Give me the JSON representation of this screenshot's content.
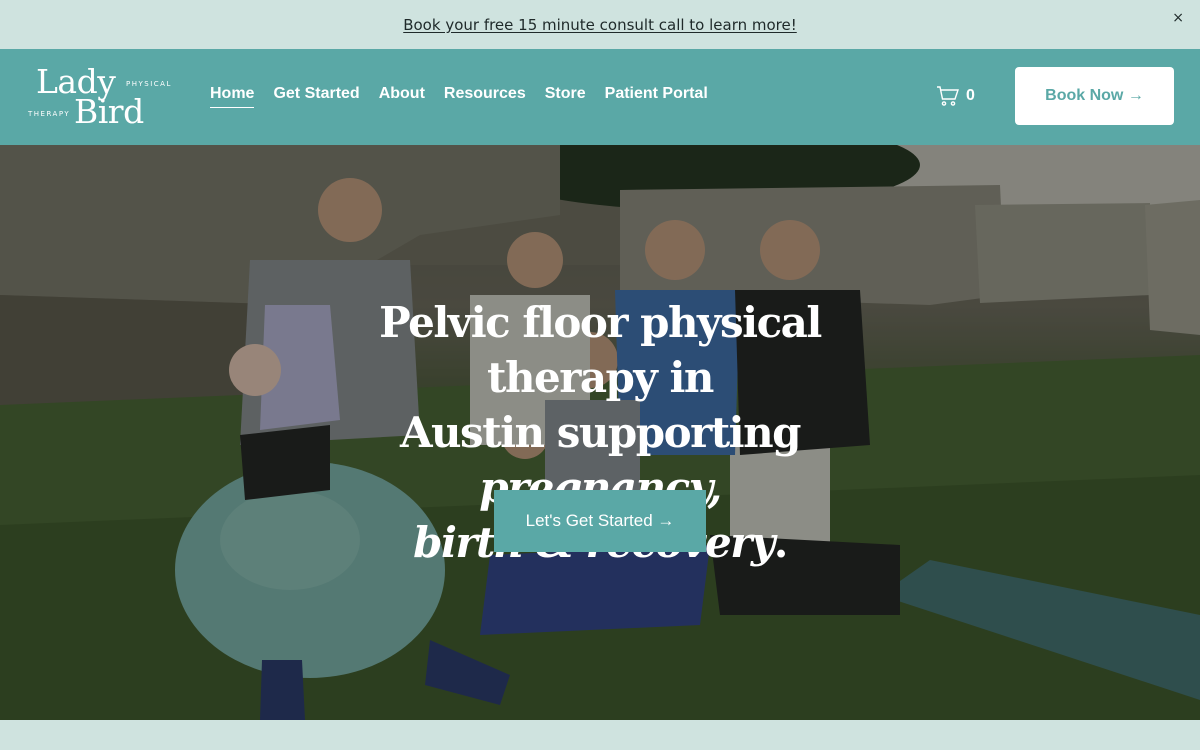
{
  "announcement": {
    "text": "Book your free 15 minute consult call to learn more!",
    "close_label": "×"
  },
  "logo": {
    "lady": "Lady",
    "bird": "Bird",
    "physical": "PHYSICAL",
    "therapy": "THERAPY"
  },
  "nav": {
    "items": [
      {
        "label": "Home",
        "active": true
      },
      {
        "label": "Get Started"
      },
      {
        "label": "About"
      },
      {
        "label": "Resources"
      },
      {
        "label": "Store"
      },
      {
        "label": "Patient Portal"
      }
    ]
  },
  "cart": {
    "count": "0",
    "icon": "cart-icon"
  },
  "header": {
    "book_label": "Book Now →"
  },
  "hero": {
    "title_line1": "Pelvic floor physical therapy in",
    "title_line2_plain": "Austin supporting ",
    "title_line2_italic": "pregnancy,",
    "title_line3_italic": "birth & recovery",
    "title_line3_plain": ".",
    "cta_label": "Let's Get Started →"
  },
  "colors": {
    "brand_teal": "#5aa8a6",
    "announcement_bg": "#cfe3df",
    "text_dark": "#1f2a2a",
    "white": "#ffffff"
  }
}
